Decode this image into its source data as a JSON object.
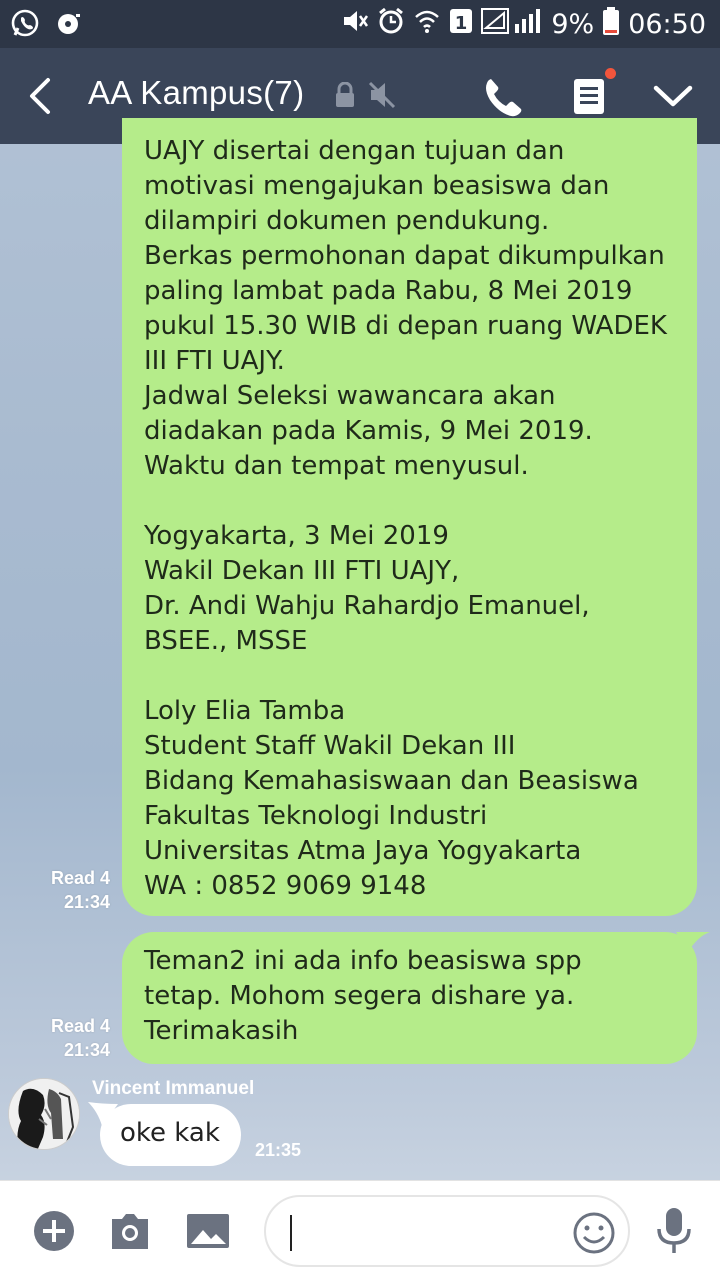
{
  "status_bar": {
    "battery_percent": "9%",
    "time": "06:50",
    "sim_slot": "1",
    "icons": [
      "whatsapp-icon",
      "music-icon",
      "mute-icon",
      "alarm-icon",
      "wifi-icon",
      "sim-icon",
      "signal-icon",
      "battery-icon"
    ]
  },
  "header": {
    "title": "AA Kampus(7)",
    "icons": [
      "back-arrow-icon",
      "lock-icon",
      "mute-icon",
      "phone-icon",
      "notes-icon",
      "chevron-down-icon"
    ]
  },
  "messages": {
    "m1": {
      "text": "UAJY disertai dengan tujuan dan\nmotivasi mengajukan beasiswa dan\ndilampiri dokumen pendukung.\nBerkas permohonan dapat dikumpulkan\npaling lambat pada Rabu, 8 Mei 2019\npukul 15.30 WIB di depan ruang WADEK\nIII FTI UAJY.\nJadwal Seleksi wawancara akan\ndiadakan pada Kamis, 9 Mei 2019.\nWaktu dan tempat menyusul.\n\nYogyakarta, 3 Mei 2019\nWakil Dekan III FTI UAJY,\nDr. Andi Wahju Rahardjo Emanuel,\nBSEE., MSSE\n\nLoly Elia Tamba\nStudent Staff Wakil Dekan III\nBidang Kemahasiswaan dan Beasiswa\nFakultas Teknologi Industri\nUniversitas Atma Jaya Yogyakarta\nWA : 0852 9069 9148",
      "read": "Read 4",
      "time": "21:34"
    },
    "m2": {
      "text": "Teman2 ini ada info beasiswa spp\ntetap. Mohom segera dishare ya.\nTerimakasih",
      "read": "Read 4",
      "time": "21:34"
    },
    "m3": {
      "sender": "Vincent Immanuel",
      "text": "oke kak",
      "time": "21:35"
    }
  },
  "input_bar": {
    "icons": [
      "plus-icon",
      "camera-icon",
      "image-icon",
      "emoji-icon",
      "microphone-icon"
    ],
    "value": ""
  },
  "colors": {
    "header_bg": "#3a4559",
    "status_bg": "#2d3646",
    "outgoing_bubble": "#b5ec8a",
    "incoming_bubble": "#ffffff"
  }
}
